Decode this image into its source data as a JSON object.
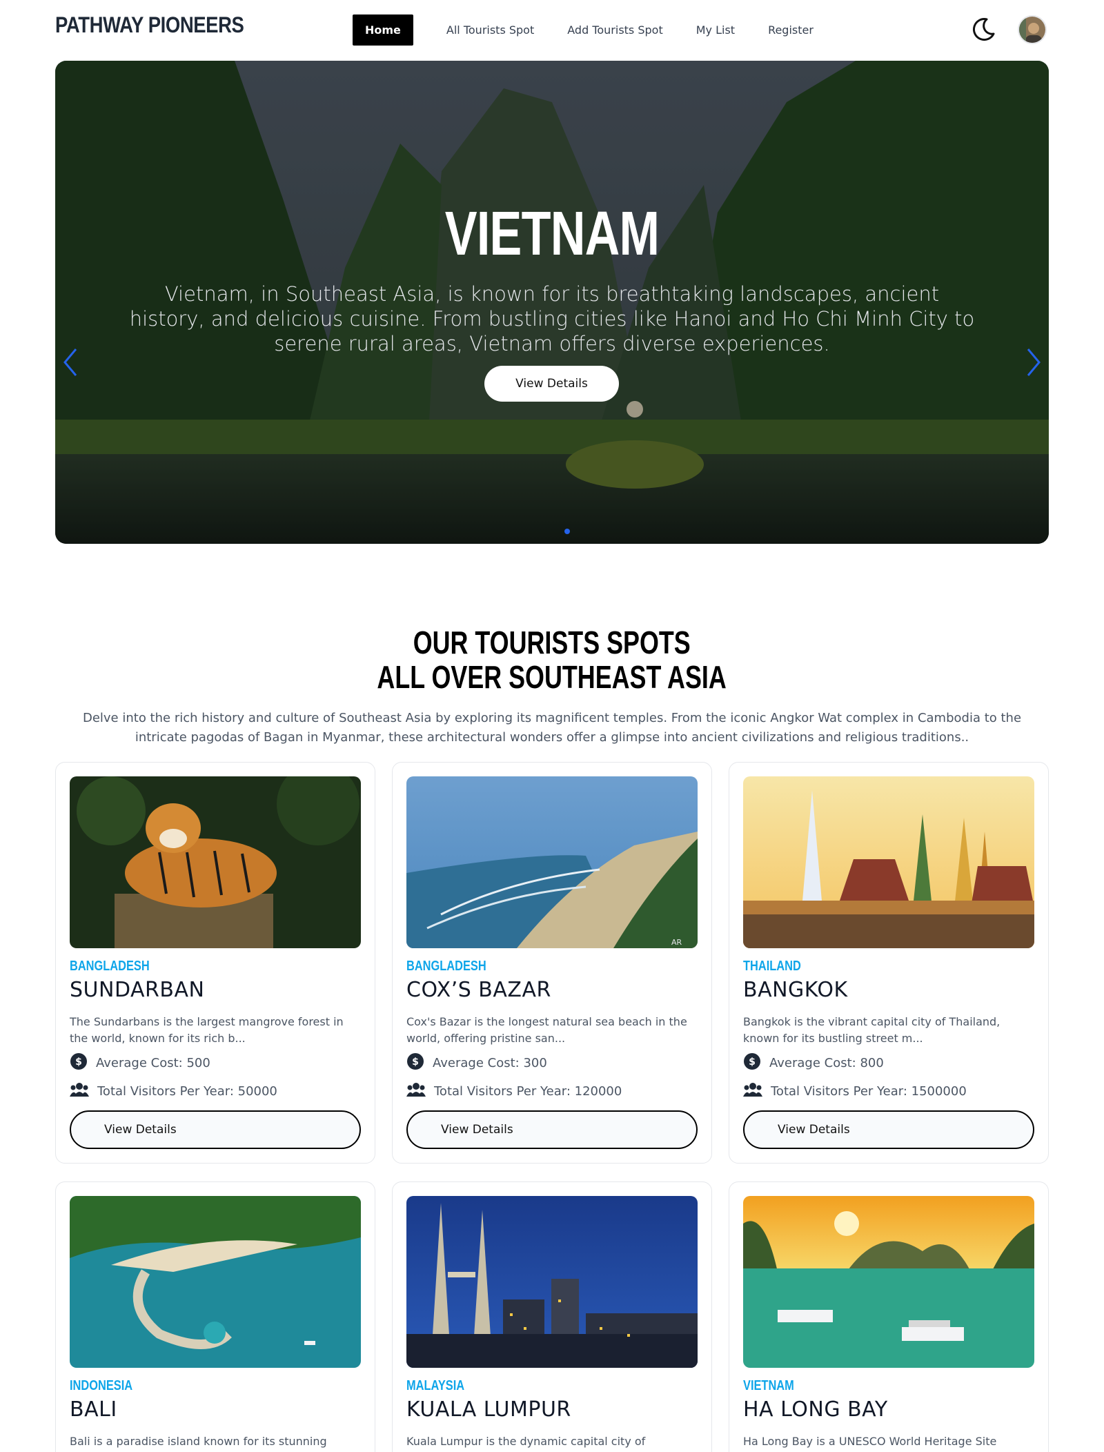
{
  "nav": {
    "logo": "PATHWAY PIONEERS",
    "links": [
      "Home",
      "All Tourists Spot",
      "Add Tourists Spot",
      "My List",
      "Register"
    ]
  },
  "hero": {
    "title": "VIETNAM",
    "description": "Vietnam, in Southeast Asia, is known for its breathtaking landscapes, ancient history, and delicious cuisine. From bustling cities like Hanoi and Ho Chi Minh City to serene rural areas, Vietnam offers diverse experiences.",
    "button": "View Details"
  },
  "section": {
    "title_line1": "OUR TOURISTS SPOTS",
    "title_line2": "ALL OVER SOUTHEAST ASIA",
    "description": "Delve into the rich history and culture of Southeast Asia by exploring its magnificent temples. From the iconic Angkor Wat complex in Cambodia to the intricate pagodas of Bagan in Myanmar, these architectural wonders offer a glimpse into ancient civilizations and religious traditions.."
  },
  "cards": [
    {
      "country": "BANGLADESH",
      "name": "SUNDARBAN",
      "description": "The Sundarbans is the largest mangrove forest in the world, known for its rich b...",
      "cost": "Average Cost: 500",
      "visitors": "Total Visitors Per Year: 50000",
      "button": "View Details"
    },
    {
      "country": "BANGLADESH",
      "name": "COX’S BAZAR",
      "description": "Cox's Bazar is the longest natural sea beach in the world, offering pristine san...",
      "cost": "Average Cost: 300",
      "visitors": "Total Visitors Per Year: 120000",
      "button": "View Details"
    },
    {
      "country": "THAILAND",
      "name": "BANGKOK",
      "description": "Bangkok is the vibrant capital city of Thailand, known for its bustling street m...",
      "cost": "Average Cost: 800",
      "visitors": "Total Visitors Per Year: 1500000",
      "button": "View Details"
    },
    {
      "country": "INDONESIA",
      "name": "BALI",
      "description": "Bali is a paradise island known for its stunning",
      "cost": "",
      "visitors": "",
      "button": ""
    },
    {
      "country": "MALAYSIA",
      "name": "KUALA LUMPUR",
      "description": "Kuala Lumpur is the dynamic capital city of",
      "cost": "",
      "visitors": "",
      "button": ""
    },
    {
      "country": "VIETNAM",
      "name": "HA LONG BAY",
      "description": "Ha Long Bay is a UNESCO World Heritage Site",
      "cost": "",
      "visitors": "",
      "button": ""
    }
  ],
  "image_watermark": "AR",
  "colors": {
    "accent": "#0ea5e9",
    "carousel_active": "#2563eb",
    "primary": "#000000"
  }
}
